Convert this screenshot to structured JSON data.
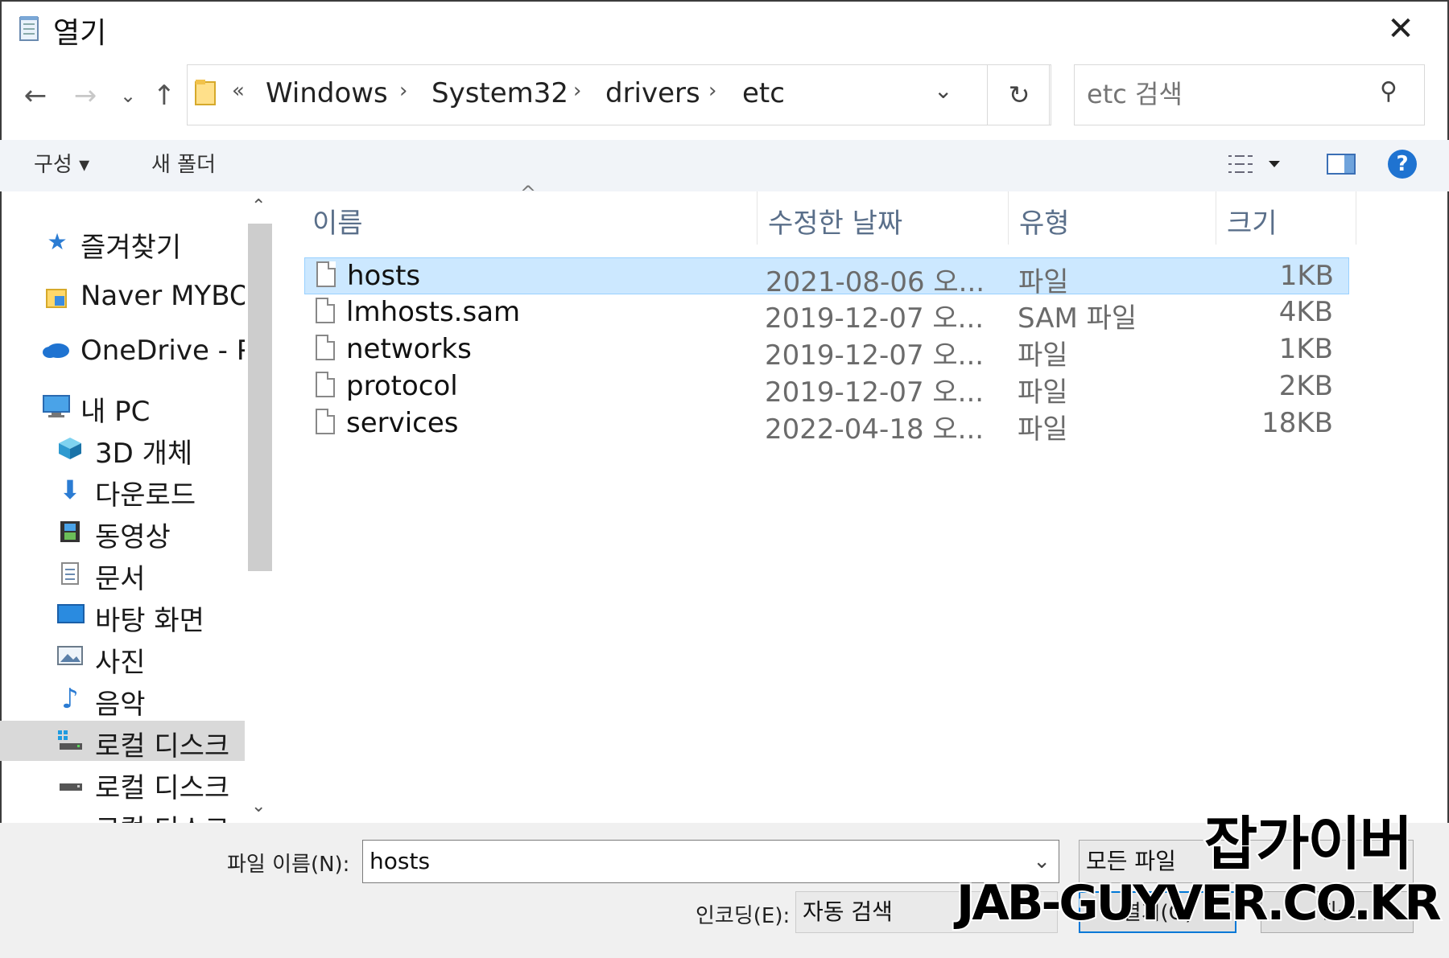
{
  "window": {
    "title": "열기",
    "close_glyph": "✕"
  },
  "nav": {
    "back_glyph": "←",
    "forward_glyph": "→",
    "recent_glyph": "⌄",
    "up_glyph": "↑",
    "breadcrumb_prefix": "«",
    "breadcrumb": [
      "Windows",
      "System32",
      "drivers",
      "etc"
    ],
    "breadcrumb_sep": "›",
    "dropdown_glyph": "⌄",
    "refresh_glyph": "↻",
    "search_placeholder": "etc 검색",
    "search_glyph": "⚲"
  },
  "toolbar": {
    "organize_label": "구성 ▾",
    "new_folder_label": "새 폴더",
    "help_glyph": "?"
  },
  "sidebar": {
    "items": [
      {
        "label": "즐겨찾기",
        "icon": "star-icon"
      },
      {
        "label": "Naver MYBO",
        "icon": "folder-icon"
      },
      {
        "label": "OneDrive - P",
        "icon": "cloud-icon"
      },
      {
        "label": "내 PC",
        "icon": "computer-icon"
      },
      {
        "label": "3D 개체",
        "icon": "cube-icon"
      },
      {
        "label": "다운로드",
        "icon": "download-icon"
      },
      {
        "label": "동영상",
        "icon": "film-icon"
      },
      {
        "label": "문서",
        "icon": "document-icon"
      },
      {
        "label": "바탕 화면",
        "icon": "desktop-icon"
      },
      {
        "label": "사진",
        "icon": "picture-icon"
      },
      {
        "label": "음악",
        "icon": "music-icon"
      },
      {
        "label": "로컬 디스크",
        "icon": "drive-icon"
      },
      {
        "label": "로컬 디스크",
        "icon": "drive-icon"
      },
      {
        "label": "로컬 디스크",
        "icon": "drive-icon"
      }
    ]
  },
  "columns": [
    "이름",
    "수정한 날짜",
    "유형",
    "크기"
  ],
  "sort_glyph": "^",
  "files": [
    {
      "name": "hosts",
      "date": "2021-08-06 오...",
      "type": "파일",
      "size": "1KB"
    },
    {
      "name": "lmhosts.sam",
      "date": "2019-12-07 오...",
      "type": "SAM 파일",
      "size": "4KB"
    },
    {
      "name": "networks",
      "date": "2019-12-07 오...",
      "type": "파일",
      "size": "1KB"
    },
    {
      "name": "protocol",
      "date": "2019-12-07 오...",
      "type": "파일",
      "size": "2KB"
    },
    {
      "name": "services",
      "date": "2022-04-18 오...",
      "type": "파일",
      "size": "18KB"
    }
  ],
  "bottom": {
    "filename_label": "파일 이름(N):",
    "filename_value": "hosts",
    "filter_value": "모든 파일",
    "encoding_label": "인코딩(E):",
    "encoding_value": "자동 검색",
    "open_label": "열기(O)",
    "cancel_label": "취소"
  },
  "watermark": {
    "korean": "잡가이버",
    "english": "JAB-GUYVER.CO.KR"
  }
}
